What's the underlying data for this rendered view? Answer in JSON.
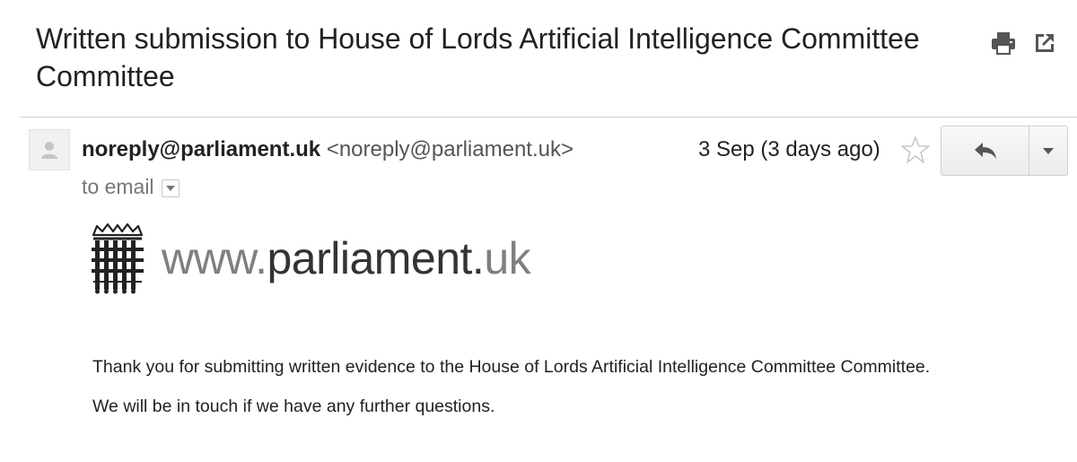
{
  "email": {
    "subject": "Written submission to House of Lords Artificial Intelligence Committee Committee",
    "sender_name": "noreply@parliament.uk",
    "sender_email": "<noreply@parliament.uk>",
    "recipient": "to email",
    "date": "3 Sep (3 days ago)",
    "logo": {
      "prefix": "www.",
      "name": "parliament",
      "dot": ".",
      "suffix": "uk"
    },
    "body": [
      "Thank you for submitting written evidence to the House of Lords Artificial Intelligence Committee Committee.",
      "We will be in touch if we have any further questions."
    ]
  },
  "icons": {
    "print": "print-icon",
    "new_window": "new-window-icon",
    "avatar": "person-icon",
    "star": "star-icon",
    "reply": "reply-icon",
    "more": "chevron-down-icon",
    "recipient_details": "chevron-down-icon",
    "logo": "portcullis-icon"
  },
  "colors": {
    "icon": "#555555",
    "divider": "#cfcfcf",
    "secondary_text": "#777777"
  }
}
